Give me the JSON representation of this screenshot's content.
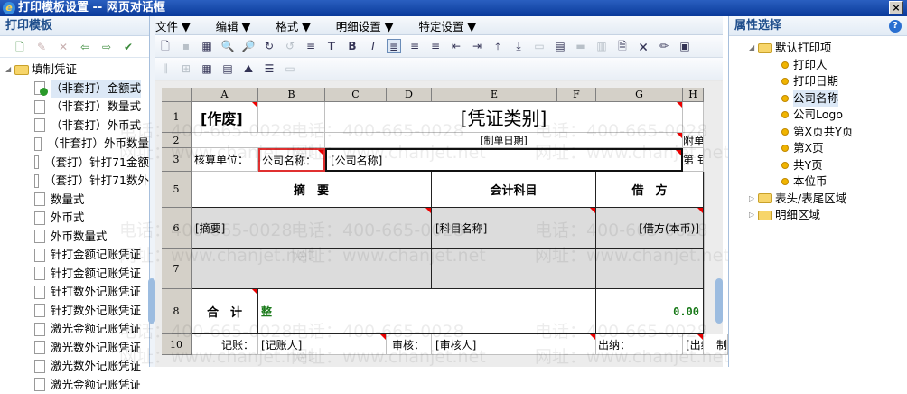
{
  "window": {
    "title": "打印模板设置 -- 网页对话框",
    "close": "×"
  },
  "watermark": {
    "phone": "电话：400-665-0028",
    "site": "网址：www.chanjet.net"
  },
  "left": {
    "title": "打印模板",
    "toolbar": [
      {
        "icon": "new-template-icon",
        "g": "🗋"
      },
      {
        "icon": "edit-icon",
        "g": "✎"
      },
      {
        "icon": "delete-icon",
        "g": "✕"
      },
      {
        "icon": "import-icon",
        "g": "⇦"
      },
      {
        "icon": "export-icon",
        "g": "⇨"
      },
      {
        "icon": "set-default-icon",
        "g": "✔"
      }
    ],
    "root": "填制凭证",
    "items": [
      "（非套打）金额式",
      "（非套打）数量式",
      "（非套打）外币式",
      "（非套打）外币数量",
      "（套打）针打71金额",
      "（套打）针打71数外",
      "数量式",
      "外币式",
      "外币数量式",
      "针打金额记账凭证",
      "针打金额记账凭证",
      "针打数外记账凭证",
      "针打数外记账凭证",
      "激光金额记账凭证",
      "激光数外记账凭证",
      "激光数外记账凭证",
      "激光金额记账凭证"
    ],
    "selected": 0
  },
  "menu": [
    "文件 ▼",
    "编辑 ▼",
    "格式 ▼",
    "明细设置 ▼",
    "特定设置 ▼"
  ],
  "toolbar1": [
    {
      "n": "new-icon",
      "g": "🗋"
    },
    {
      "n": "save-icon",
      "g": "▪",
      "d": 1
    },
    {
      "n": "design-icon",
      "g": "▦"
    },
    {
      "n": "preview-icon",
      "g": "🔍"
    },
    {
      "n": "print-preview-icon",
      "g": "🔎"
    },
    {
      "n": "redo-icon",
      "g": "↻"
    },
    {
      "n": "undo-icon",
      "g": "↺",
      "d": 1
    },
    {
      "n": "format-icon",
      "g": "≡"
    },
    {
      "n": "text-icon",
      "g": "T"
    },
    {
      "n": "bold-icon",
      "g": "B"
    },
    {
      "n": "italic-icon",
      "g": "I"
    },
    {
      "n": "align-left-icon",
      "g": "≣",
      "s": 1
    },
    {
      "n": "align-center-icon",
      "g": "≡"
    },
    {
      "n": "align-right-icon",
      "g": "≡"
    },
    {
      "n": "insert-col-left-icon",
      "g": "⇤"
    },
    {
      "n": "insert-col-right-icon",
      "g": "⇥"
    },
    {
      "n": "insert-row-up-icon",
      "g": "⤒"
    },
    {
      "n": "insert-row-down-icon",
      "g": "⤓"
    },
    {
      "n": "merge-icon",
      "g": "▭",
      "d": 1
    },
    {
      "n": "border-icon",
      "g": "▤"
    },
    {
      "n": "split-icon",
      "g": "▬",
      "d": 1
    },
    {
      "n": "split-col-icon",
      "g": "▥",
      "d": 1
    },
    {
      "n": "add-page-icon",
      "g": "🗎"
    },
    {
      "n": "remove-page-icon",
      "g": "🗙"
    },
    {
      "n": "pencil-icon",
      "g": "✏"
    },
    {
      "n": "page-setup-icon",
      "g": "▣"
    }
  ],
  "toolbar2": [
    {
      "n": "columns-icon",
      "g": "⫼",
      "d": 1
    },
    {
      "n": "rows-icon",
      "g": "⊞",
      "d": 1
    },
    {
      "n": "grid-icon",
      "g": "▦"
    },
    {
      "n": "frame-icon",
      "g": "▤"
    },
    {
      "n": "image-icon",
      "g": "⛰"
    },
    {
      "n": "list-icon",
      "g": "☰"
    },
    {
      "n": "open-icon",
      "g": "▭",
      "d": 1
    }
  ],
  "sheet": {
    "cols": [
      "A",
      "B",
      "C",
      "D",
      "E",
      "F",
      "G",
      "H"
    ],
    "rows": [
      "1",
      "2",
      "3",
      "5",
      "6",
      "7",
      "8",
      "10"
    ],
    "void": "[作废]",
    "voucher_type": "[凭证类别]",
    "date": "[制单日期]",
    "attach": "附单",
    "unit_label": "核算单位：",
    "company_label": "公司名称：",
    "company_value": "[公司名称]",
    "page_label": "第 钅",
    "h_summary": "摘　要",
    "h_account": "会计科目",
    "h_debit": "借　方",
    "summary": "[摘要]",
    "account": "[科目名称]",
    "debit": "[借方(本币)]",
    "total": "合　计",
    "total_words": "整",
    "total_value": "0.00",
    "bookkeeper_label": "记账：",
    "bookkeeper": "[记账人]",
    "auditor_label": "审核：",
    "auditor": "[审核人]",
    "cashier_label": "出纳：",
    "cashier": "[出纳]",
    "maker_cut": "制"
  },
  "right": {
    "title": "属性选择",
    "help": "?",
    "root": "默认打印项",
    "items": [
      "打印人",
      "打印日期",
      "公司名称",
      "公司Logo",
      "第X页共Y页",
      "第X页",
      "共Y页",
      "本位币"
    ],
    "selected": 2,
    "folders": [
      "表头/表尾区域",
      "明细区域"
    ]
  },
  "colors": {
    "accent": "#1f4e8c",
    "selection": "#dce8f6",
    "highlight_box": "#e03030",
    "comment_marker": "#e00000",
    "total_green": "#1a7a1a"
  }
}
